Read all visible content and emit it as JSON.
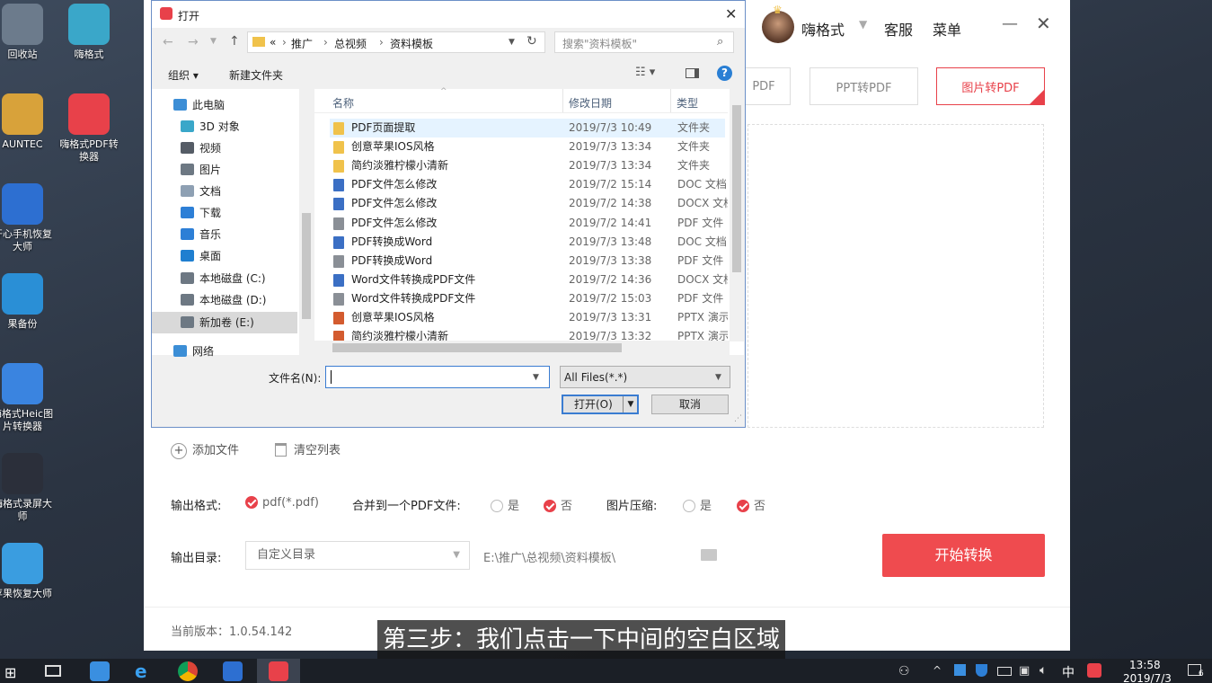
{
  "desktop": {
    "icons": [
      {
        "label": "回收站",
        "color": "#6c7b8c"
      },
      {
        "label": "嗨格式",
        "color": "#3aa7c9"
      },
      {
        "label": "AUNTEC",
        "color": "#d8a23a"
      },
      {
        "label": "嗨格式PDF转换器",
        "color": "#e8414a"
      },
      {
        "label": "开心手机恢复大师",
        "color": "#2d6fd1"
      },
      {
        "label": "果备份",
        "color": "#2a8fd6"
      },
      {
        "label": "嗨格式Heic图片转换器",
        "color": "#3a84e0"
      },
      {
        "label": "嗨格式录屏大师",
        "color": "#2b2f3a"
      },
      {
        "label": "苹果恢复大师",
        "color": "#3a9de0"
      }
    ]
  },
  "app": {
    "username": "嗨格式",
    "service": "客服",
    "menu": "菜单",
    "tabs": {
      "pdf": "PDF",
      "ppt": "PPT转PDF",
      "image": "图片转PDF"
    },
    "add_file": "添加文件",
    "clear_list": "清空列表",
    "output_format_label": "输出格式:",
    "output_format_value": "pdf(*.pdf)",
    "merge_label": "合并到一个PDF文件:",
    "yes": "是",
    "no": "否",
    "compress_label": "图片压缩:",
    "output_dir_label": "输出目录:",
    "output_dir_select": "自定义目录",
    "output_dir_path": "E:\\推广\\总视频\\资料模板\\",
    "start_button": "开始转换",
    "version": "当前版本：1.0.54.142",
    "accent": "#e8414a"
  },
  "dialog": {
    "title": "打开",
    "breadcrumb": [
      "«",
      "推广",
      "总视频",
      "资料模板"
    ],
    "search_placeholder": "搜索\"资料模板\"",
    "organize": "组织 ▾",
    "new_folder": "新建文件夹",
    "nav": [
      {
        "label": "此电脑",
        "color": "#3c8ed6"
      },
      {
        "label": "3D 对象",
        "color": "#3aa7c9"
      },
      {
        "label": "视频",
        "color": "#555c66"
      },
      {
        "label": "图片",
        "color": "#6d7883"
      },
      {
        "label": "文档",
        "color": "#8ea0b3"
      },
      {
        "label": "下载",
        "color": "#2d7fd6"
      },
      {
        "label": "音乐",
        "color": "#2d7fd6"
      },
      {
        "label": "桌面",
        "color": "#1f7fd0"
      },
      {
        "label": "本地磁盘 (C:)",
        "color": "#6d7883"
      },
      {
        "label": "本地磁盘 (D:)",
        "color": "#6d7883"
      },
      {
        "label": "新加卷 (E:)",
        "color": "#6d7883"
      },
      {
        "label": "网络",
        "color": "#3c8ed6"
      }
    ],
    "columns": {
      "name": "名称",
      "date": "修改日期",
      "type": "类型"
    },
    "files": [
      {
        "name": "PDF页面提取",
        "date": "2019/7/3 10:49",
        "type": "文件夹",
        "icon": "#f0c24b"
      },
      {
        "name": "创意苹果IOS风格",
        "date": "2019/7/3 13:34",
        "type": "文件夹",
        "icon": "#f0c24b"
      },
      {
        "name": "简约淡雅柠檬小清新",
        "date": "2019/7/3 13:34",
        "type": "文件夹",
        "icon": "#f0c24b"
      },
      {
        "name": "PDF文件怎么修改",
        "date": "2019/7/2 15:14",
        "type": "DOC 文档",
        "icon": "#3b6fc4"
      },
      {
        "name": "PDF文件怎么修改",
        "date": "2019/7/2 14:38",
        "type": "DOCX 文档",
        "icon": "#3b6fc4"
      },
      {
        "name": "PDF文件怎么修改",
        "date": "2019/7/2 14:41",
        "type": "PDF 文件",
        "icon": "#8a8f96"
      },
      {
        "name": "PDF转换成Word",
        "date": "2019/7/3 13:48",
        "type": "DOC 文档",
        "icon": "#3b6fc4"
      },
      {
        "name": "PDF转换成Word",
        "date": "2019/7/3 13:38",
        "type": "PDF 文件",
        "icon": "#8a8f96"
      },
      {
        "name": "Word文件转换成PDF文件",
        "date": "2019/7/2 14:36",
        "type": "DOCX 文档",
        "icon": "#3b6fc4"
      },
      {
        "name": "Word文件转换成PDF文件",
        "date": "2019/7/2 15:03",
        "type": "PDF 文件",
        "icon": "#8a8f96"
      },
      {
        "name": "创意苹果IOS风格",
        "date": "2019/7/3 13:31",
        "type": "PPTX 演示",
        "icon": "#d35b2f"
      },
      {
        "name": "简约淡雅柠檬小清新",
        "date": "2019/7/3 13:32",
        "type": "PPTX 演示",
        "icon": "#d35b2f"
      }
    ],
    "filename_label": "文件名(N):",
    "filename_value": "",
    "filter": "All Files(*.*)",
    "open_button": "打开(O)",
    "cancel_button": "取消"
  },
  "subtitle": "第三步：我们点击一下中间的空白区域",
  "taskbar": {
    "ime": "中",
    "time": "13:58",
    "date": "2019/7/3",
    "notify_count": "6"
  }
}
